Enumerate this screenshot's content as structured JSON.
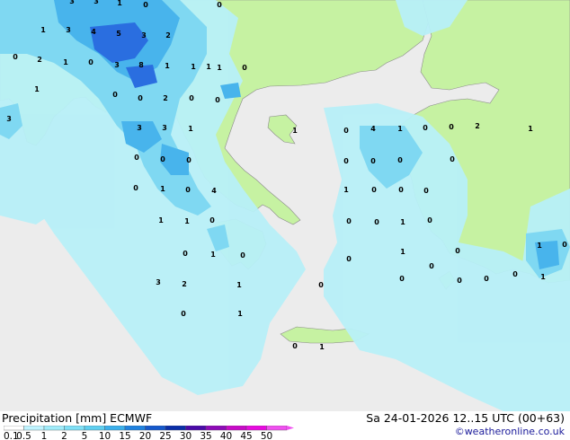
{
  "footer": {
    "title": "Precipitation [mm]  ECMWF",
    "date": "Sa 24-01-2026 12..15 UTC (00+63)",
    "credit": "©weatheronline.co.uk"
  },
  "legend": {
    "ticks": [
      "0.1",
      "0.5",
      "1",
      "2",
      "5",
      "10",
      "15",
      "20",
      "25",
      "30",
      "35",
      "40",
      "45",
      "50"
    ],
    "colors": [
      "#ffffff",
      "#bff4ff",
      "#a0ecfa",
      "#7fe0f6",
      "#5ecff0",
      "#3bb0ec",
      "#1f82e0",
      "#1458cc",
      "#0a2ea8",
      "#4a0aa8",
      "#8e0ab8",
      "#c80ac8",
      "#e80ae0",
      "#f050f0"
    ]
  },
  "map_colors": {
    "sea": "#ececec",
    "land": "#c6f2a2",
    "precip_light": "#b8f0f8",
    "precip_medium": "#7fd8f2",
    "precip_heavy": "#48b4ec",
    "precip_strong": "#2a6ee0"
  },
  "map_values": [
    {
      "v": "3"
    },
    {
      "v": "3"
    },
    {
      "v": "1"
    },
    {
      "v": "0"
    },
    {
      "v": "0"
    },
    {
      "v": "1"
    },
    {
      "v": "3"
    },
    {
      "v": "4"
    },
    {
      "v": "5"
    },
    {
      "v": "3"
    },
    {
      "v": "2"
    },
    {
      "v": "0"
    },
    {
      "v": "2"
    },
    {
      "v": "1"
    },
    {
      "v": "0"
    },
    {
      "v": "3"
    },
    {
      "v": "8"
    },
    {
      "v": "1"
    },
    {
      "v": "1"
    },
    {
      "v": "1"
    },
    {
      "v": "1"
    },
    {
      "v": "0"
    },
    {
      "v": "1"
    },
    {
      "v": "0"
    },
    {
      "v": "0"
    },
    {
      "v": "2"
    },
    {
      "v": "0"
    },
    {
      "v": "0"
    },
    {
      "v": "3"
    },
    {
      "v": "3"
    },
    {
      "v": "3"
    },
    {
      "v": "1"
    },
    {
      "v": "1"
    },
    {
      "v": "0"
    },
    {
      "v": "4"
    },
    {
      "v": "1"
    },
    {
      "v": "0"
    },
    {
      "v": "0"
    },
    {
      "v": "2"
    },
    {
      "v": "1"
    },
    {
      "v": "0"
    },
    {
      "v": "0"
    },
    {
      "v": "0"
    },
    {
      "v": "0"
    },
    {
      "v": "0"
    },
    {
      "v": "0"
    },
    {
      "v": "0"
    },
    {
      "v": "0"
    },
    {
      "v": "1"
    },
    {
      "v": "0"
    },
    {
      "v": "4"
    },
    {
      "v": "1"
    },
    {
      "v": "0"
    },
    {
      "v": "0"
    },
    {
      "v": "0"
    },
    {
      "v": "1"
    },
    {
      "v": "1"
    },
    {
      "v": "0"
    },
    {
      "v": "0"
    },
    {
      "v": "0"
    },
    {
      "v": "1"
    },
    {
      "v": "0"
    },
    {
      "v": "0"
    },
    {
      "v": "1"
    },
    {
      "v": "0"
    },
    {
      "v": "1"
    },
    {
      "v": "0"
    },
    {
      "v": "1"
    },
    {
      "v": "0"
    },
    {
      "v": "0"
    },
    {
      "v": "1"
    },
    {
      "v": "0"
    },
    {
      "v": "0"
    },
    {
      "v": "0"
    },
    {
      "v": "1"
    },
    {
      "v": "3"
    },
    {
      "v": "2"
    },
    {
      "v": "1"
    },
    {
      "v": "0"
    },
    {
      "v": "0"
    },
    {
      "v": "1"
    },
    {
      "v": "0"
    },
    {
      "v": "0"
    },
    {
      "v": "0"
    }
  ]
}
